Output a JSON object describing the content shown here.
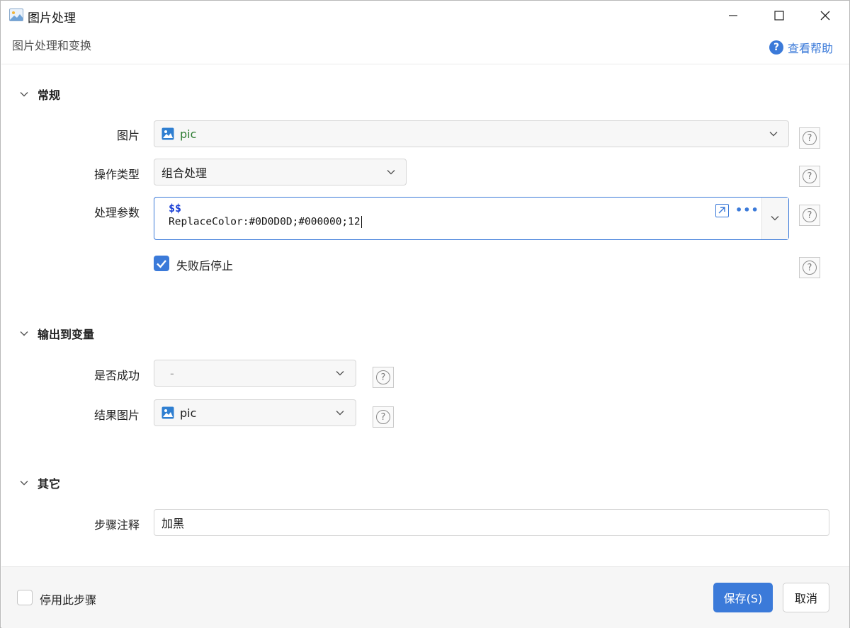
{
  "window": {
    "title": "图片处理"
  },
  "header": {
    "subtitle": "图片处理和变换",
    "help_label": "查看帮助"
  },
  "sections": {
    "general": {
      "title": "常规",
      "image_label": "图片",
      "image_value": "pic",
      "op_type_label": "操作类型",
      "op_type_value": "组合处理",
      "params_label": "处理参数",
      "params_prefix": "$$",
      "params_code": "ReplaceColor:#0D0D0D;#000000;12",
      "stop_on_fail_label": "失败后停止",
      "stop_on_fail_checked": true
    },
    "output": {
      "title": "输出到变量",
      "success_label": "是否成功",
      "success_value": "-",
      "result_label": "结果图片",
      "result_value": "pic"
    },
    "other": {
      "title": "其它",
      "comment_label": "步骤注释",
      "comment_value": "加黑"
    }
  },
  "footer": {
    "disable_label": "停用此步骤",
    "disable_checked": false,
    "save_label": "保存(S)",
    "cancel_label": "取消"
  },
  "colors": {
    "accent": "#3b7ad9",
    "variable_green": "#2e7d32",
    "dollar_blue": "#1a3fd6"
  }
}
